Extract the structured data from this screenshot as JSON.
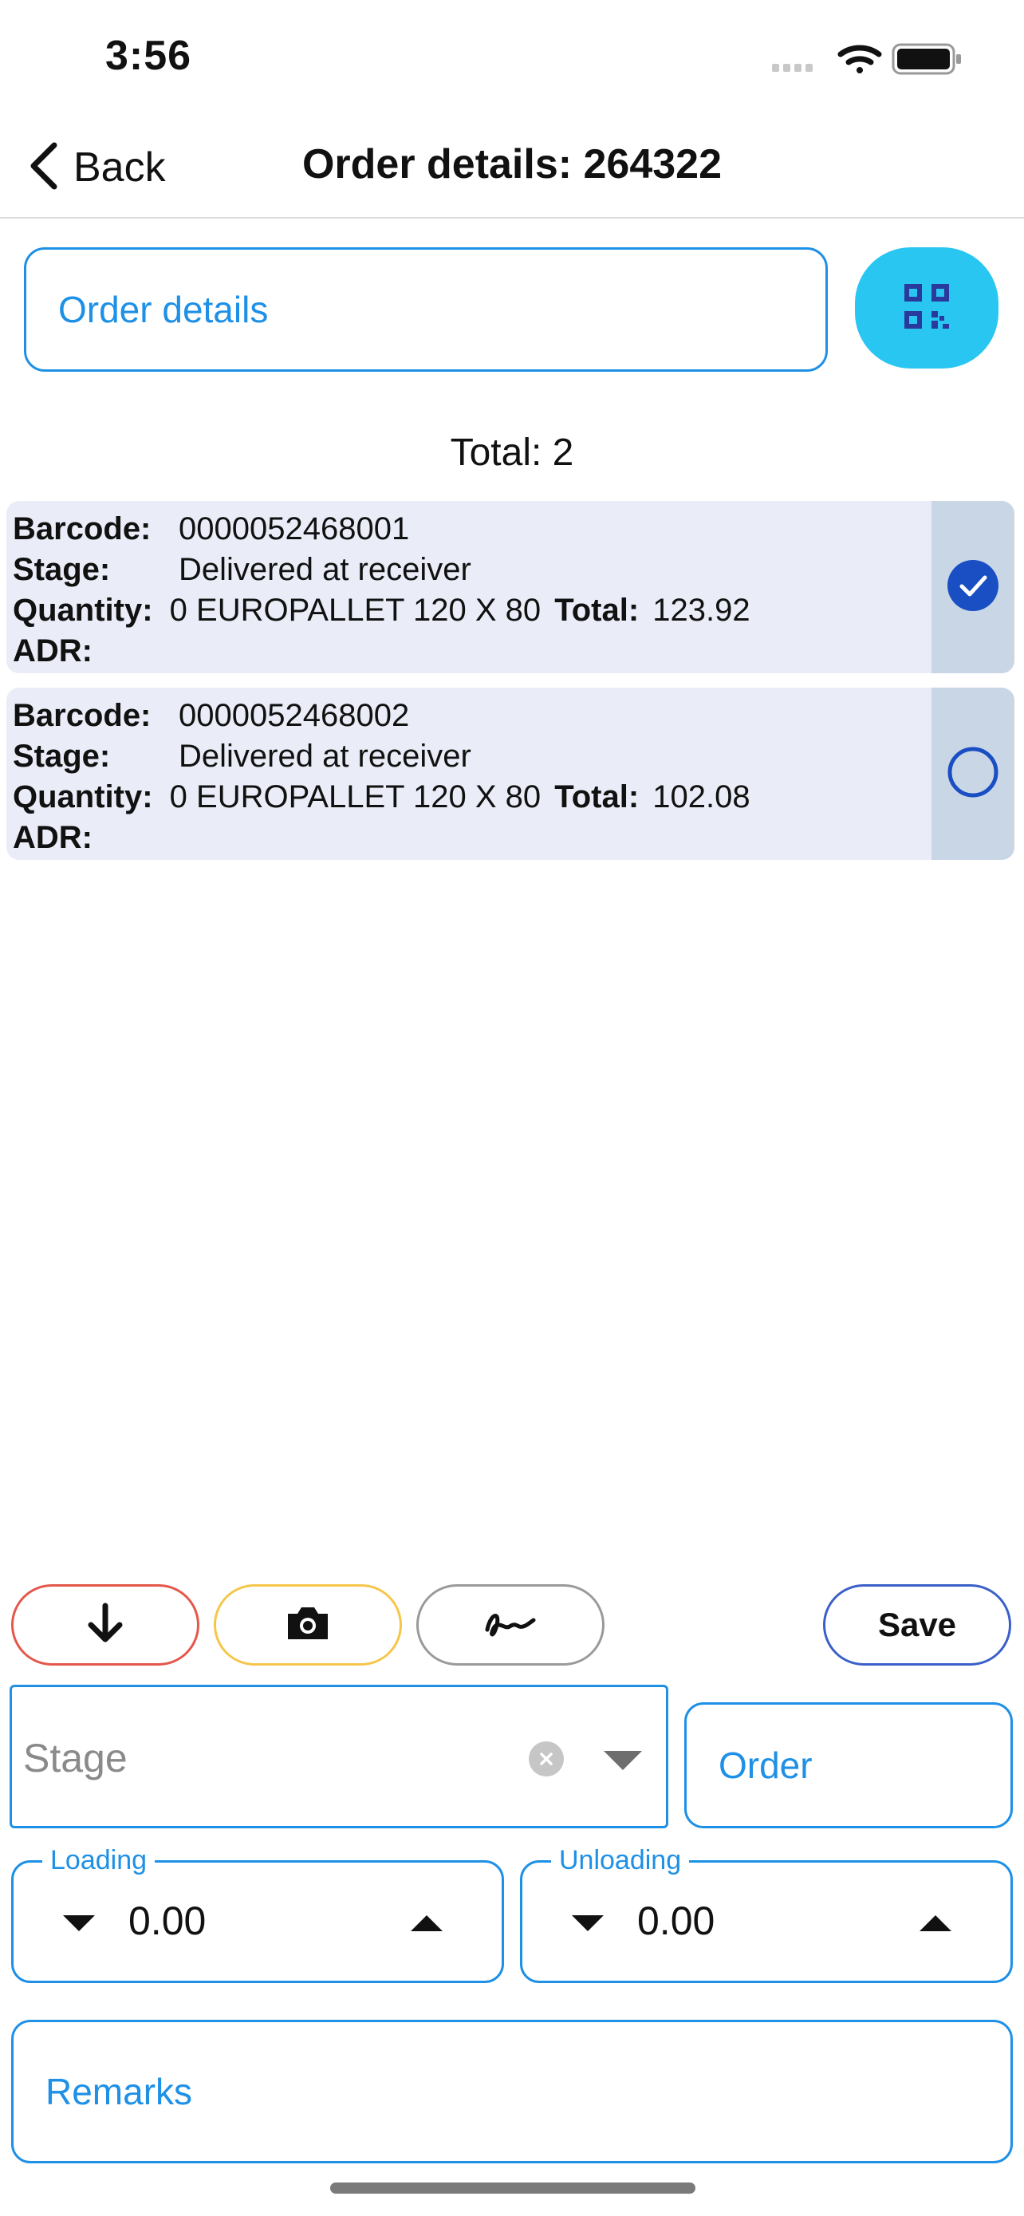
{
  "status_bar": {
    "time": "3:56"
  },
  "nav": {
    "back_label": "Back",
    "title": "Order details: 264322"
  },
  "search": {
    "placeholder": "Order details"
  },
  "list": {
    "total_label": "Total: 2",
    "items": [
      {
        "barcode_label": "Barcode:",
        "barcode": "0000052468001",
        "stage_label": "Stage:",
        "stage": "Delivered at receiver",
        "quantity_label": "Quantity:",
        "quantity": "0 EUROPALLET 120 X 80",
        "total_label": "Total:",
        "total": "123.92",
        "adr_label": "ADR:",
        "selected": true
      },
      {
        "barcode_label": "Barcode:",
        "barcode": "0000052468002",
        "stage_label": "Stage:",
        "stage": "Delivered at receiver",
        "quantity_label": "Quantity:",
        "quantity": "0 EUROPALLET 120 X 80",
        "total_label": "Total:",
        "total": "102.08",
        "adr_label": "ADR:",
        "selected": false
      }
    ]
  },
  "toolbar": {
    "save_label": "Save"
  },
  "form": {
    "stage_placeholder": "Stage",
    "order_label": "Order",
    "loading": {
      "label": "Loading",
      "value": "0.00"
    },
    "unloading": {
      "label": "Unloading",
      "value": "0.00"
    },
    "remarks_label": "Remarks"
  },
  "colors": {
    "accent": "#1e90e6",
    "qr_button": "#29c6f2",
    "check": "#1a4fc4"
  }
}
